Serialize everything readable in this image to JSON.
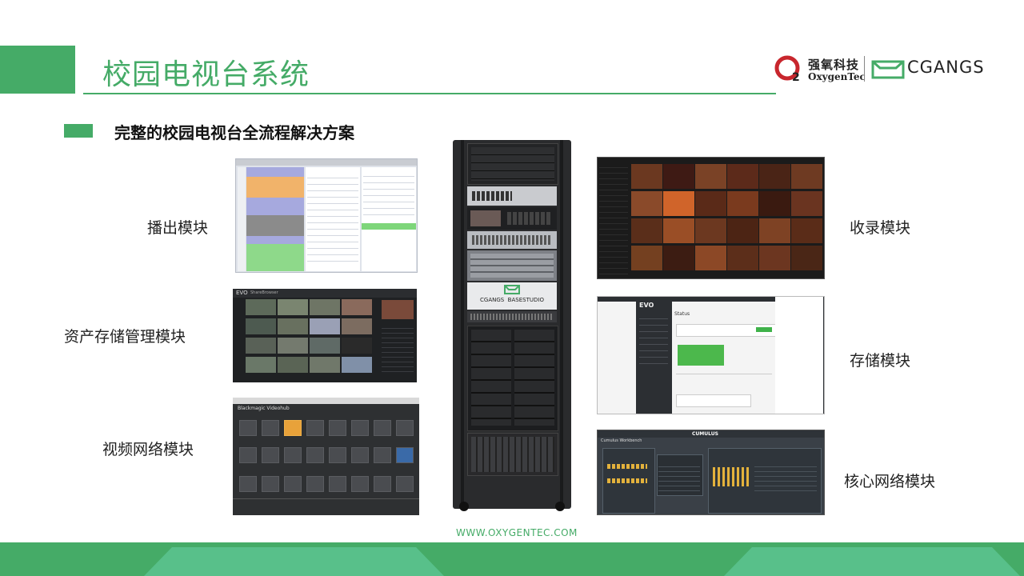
{
  "header": {
    "title": "校园电视台系统",
    "brand_cn": "强氧科技",
    "brand_en": "OxygenTec",
    "partner": "CGANGS"
  },
  "subtitle": "完整的校园电视台全流程解决方案",
  "modules": {
    "playout": "播出模块",
    "asset": "资产存储管理模块",
    "video_network": "视频网络模块",
    "recording": "收录模块",
    "storage": "存储模块",
    "core_network": "核心网络模块"
  },
  "rack": {
    "brand_label": "CGANGS  BASESTUDIO"
  },
  "screens": {
    "asset_app": "ShareBrowser",
    "asset_brand": "EVO",
    "videohub_title": "Blackmagic Videohub",
    "storage_brand": "EVO",
    "storage_heading": "Status",
    "core_app": "Cumulus Workbench",
    "core_brand": "CUMULUS"
  },
  "footer": {
    "website": "WWW.OXYGENTEC.COM"
  },
  "colors": {
    "accent": "#45ab67",
    "accent_light": "#58c08a"
  }
}
